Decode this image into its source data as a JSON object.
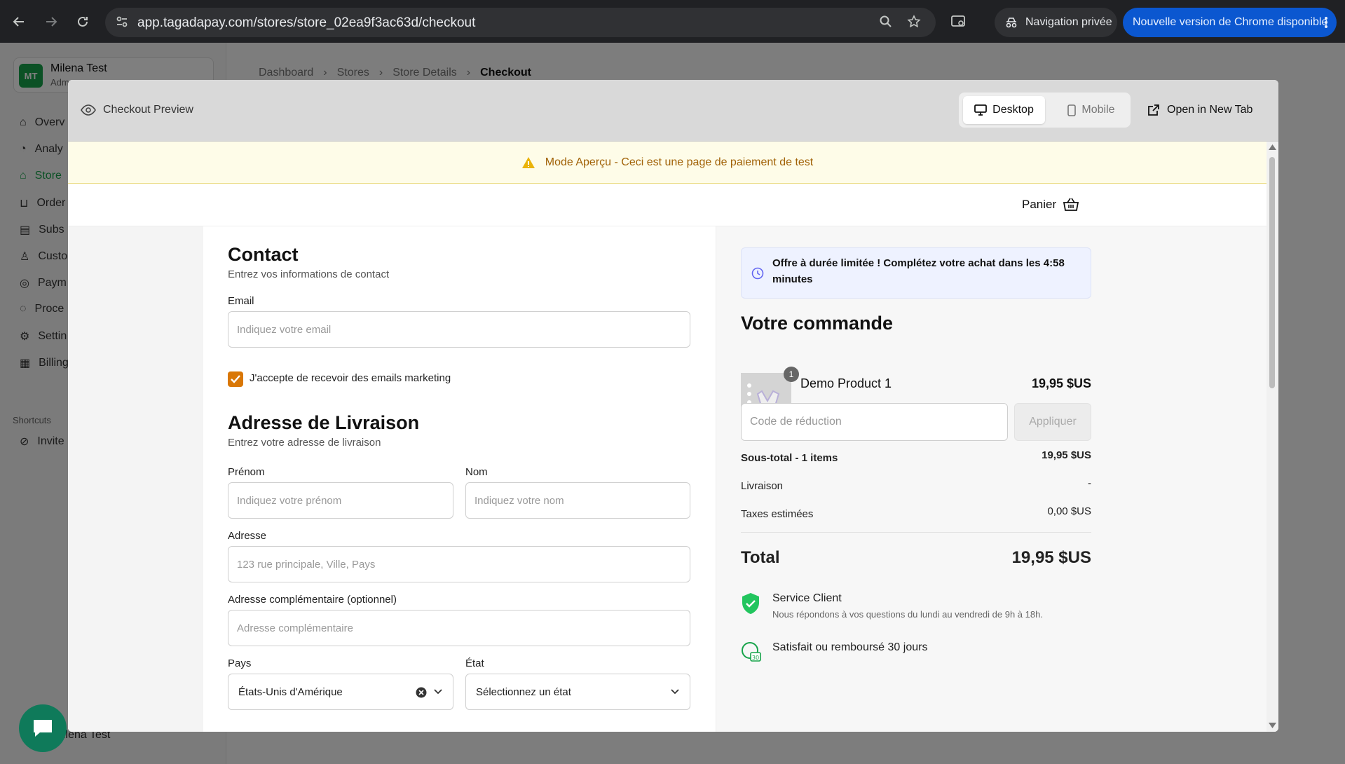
{
  "browser": {
    "url": "app.tagadapay.com/stores/store_02ea9f3ac63d/checkout",
    "private_label": "Navigation privée",
    "update_label": "Nouvelle version de Chrome disponible"
  },
  "app": {
    "org": {
      "initials": "MT",
      "name": "Milena Test",
      "role": "Adm"
    },
    "sidebar": [
      {
        "label": "Overv",
        "icon": "home-icon"
      },
      {
        "label": "Analy",
        "icon": "chart-icon"
      },
      {
        "label": "Store",
        "icon": "store-icon",
        "active": true
      },
      {
        "label": "Order",
        "icon": "cart-icon"
      },
      {
        "label": "Subs",
        "icon": "subscription-icon"
      },
      {
        "label": "Custo",
        "icon": "user-icon"
      },
      {
        "label": "Paym",
        "icon": "payment-icon"
      },
      {
        "label": "Proce",
        "icon": "processor-icon"
      },
      {
        "label": "Settin",
        "icon": "gear-icon"
      },
      {
        "label": "Billing",
        "icon": "billing-icon"
      }
    ],
    "shortcuts_label": "Shortcuts",
    "shortcut_invite": "Invite",
    "user_name": "ilena Test",
    "breadcrumb": [
      "Dashboard",
      "Stores",
      "Store Details",
      "Checkout"
    ]
  },
  "modal": {
    "title": "Checkout Preview",
    "view_desktop": "Desktop",
    "view_mobile": "Mobile",
    "open_new_tab": "Open in New Tab",
    "banner": "Mode Aperçu - Ceci est une page de paiement de test",
    "cart_label": "Panier"
  },
  "contact": {
    "title": "Contact",
    "subtitle": "Entrez vos informations de contact",
    "email_label": "Email",
    "email_placeholder": "Indiquez votre email",
    "marketing_label": "J'accepte de recevoir des emails marketing",
    "marketing_checked": true
  },
  "shipping": {
    "title": "Adresse de Livraison",
    "subtitle": "Entrez votre adresse de livraison",
    "first_name_label": "Prénom",
    "first_name_placeholder": "Indiquez votre prénom",
    "last_name_label": "Nom",
    "last_name_placeholder": "Indiquez votre nom",
    "address_label": "Adresse",
    "address_placeholder": "123 rue principale, Ville, Pays",
    "address2_label": "Adresse complémentaire (optionnel)",
    "address2_placeholder": "Adresse complémentaire",
    "country_label": "Pays",
    "country_value": "États-Unis d'Amérique",
    "state_label": "État",
    "state_placeholder": "Sélectionnez un état"
  },
  "order": {
    "offer": "Offre à durée limitée ! Complétez votre achat dans les 4:58 minutes",
    "title": "Votre commande",
    "product": {
      "name": "Demo Product 1",
      "qty": "1",
      "price": "19,95 $US"
    },
    "discount_placeholder": "Code de réduction",
    "apply_label": "Appliquer",
    "subtotal_label": "Sous-total - 1 items",
    "subtotal_value": "19,95 $US",
    "shipping_label": "Livraison",
    "shipping_value": "-",
    "tax_label": "Taxes estimées",
    "tax_value": "0,00 $US",
    "total_label": "Total",
    "total_value": "19,95 $US",
    "feature1_title": "Service Client",
    "feature1_sub": "Nous répondons à vos questions du lundi au vendredi de 9h à 18h.",
    "feature2_title": "Satisfait ou remboursé 30 jours"
  },
  "colors": {
    "accent": "#16a34a",
    "banner_bg": "#fefce8",
    "banner_text": "#a16207",
    "checkbox": "#d97706",
    "chrome_blue": "#0b57d0"
  }
}
